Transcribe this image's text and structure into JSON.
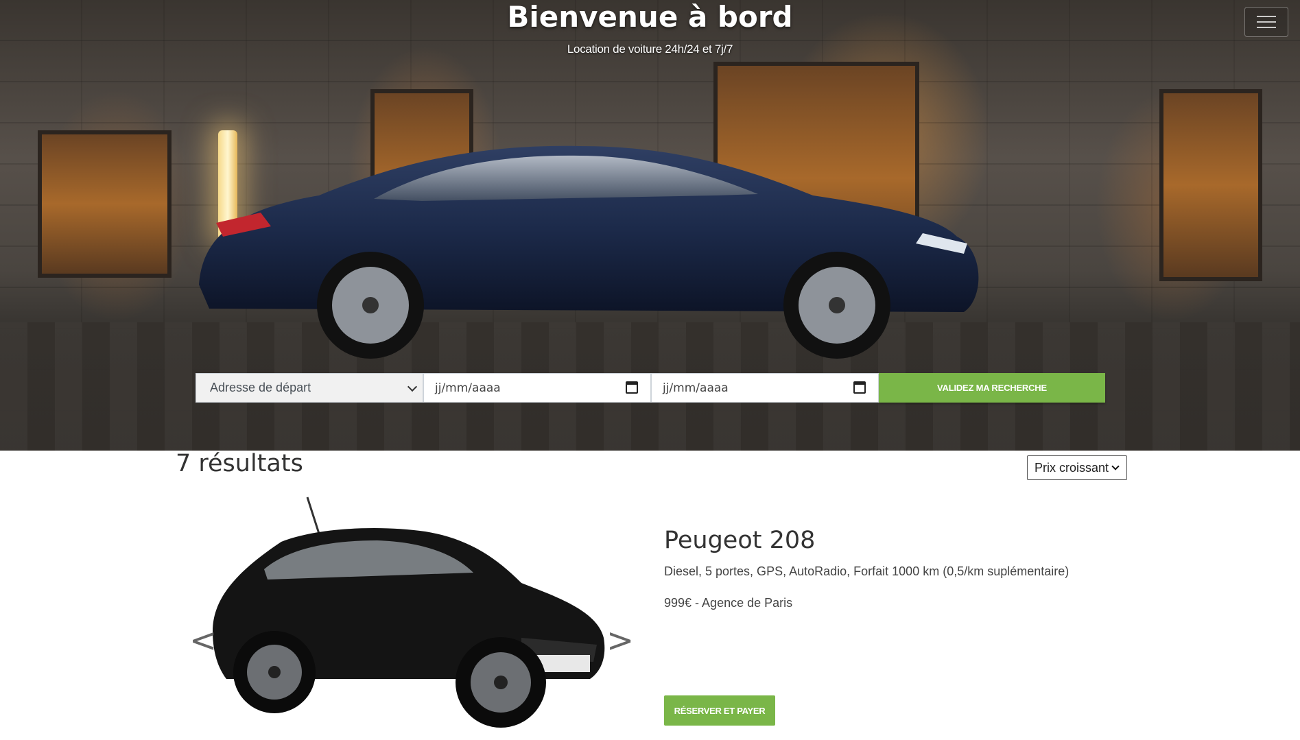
{
  "hero": {
    "title": "Bienvenue à bord",
    "subtitle": "Location de voiture 24h/24 et 7j/7",
    "menu_icon": "hamburger-icon"
  },
  "search": {
    "departure_label": "Adresse de départ",
    "start_date_placeholder": "jj/mm/aaaa",
    "end_date_placeholder": "jj/mm/aaaa",
    "submit_label": "VALIDEZ MA RECHERCHE"
  },
  "results": {
    "count_label": "7 résultats",
    "sort_value": "Prix croissant"
  },
  "car": {
    "title": "Peugeot 208",
    "description": "Diesel, 5 portes, GPS, AutoRadio, Forfait 1000 km (0,5/km suplémentaire)",
    "price_agency": "999€ - Agence de Paris",
    "reserve_label": "RÉSERVER ET PAYER",
    "prev_arrow": "<",
    "next_arrow": ">"
  },
  "colors": {
    "accent": "#7ab648",
    "hero_car": "#1c2a4a",
    "card_car": "#141414"
  }
}
